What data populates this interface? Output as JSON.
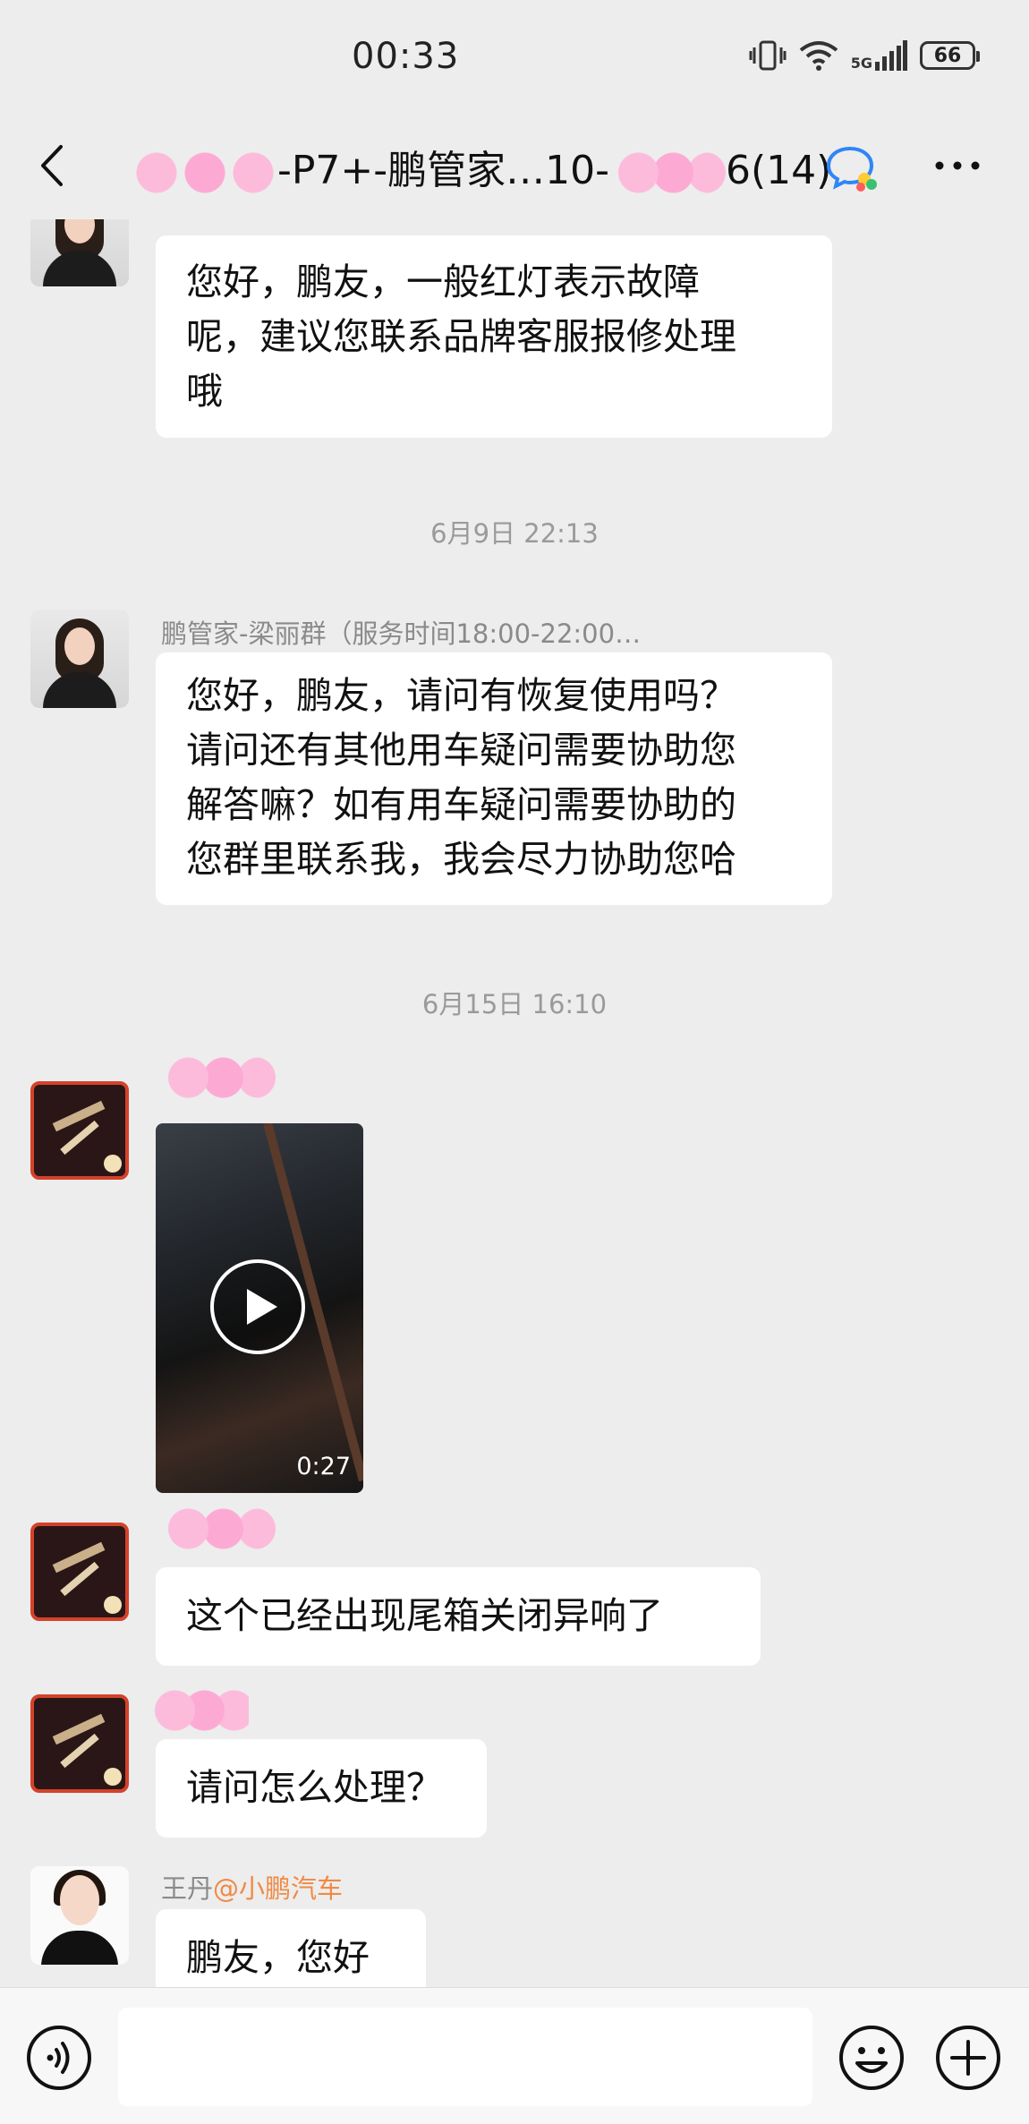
{
  "status_bar": {
    "time": "00:33",
    "network": "5G",
    "battery": "66",
    "icons": [
      "vibrate-icon",
      "wifi-icon",
      "signal-icon",
      "battery-icon"
    ]
  },
  "header": {
    "title_part1": "-P7+-鹏管家…10-",
    "title_part2": "6(14)",
    "icons": [
      "back-arrow-icon",
      "group-chat-icon",
      "more-icon"
    ]
  },
  "messages": [
    {
      "type": "text",
      "sender": "",
      "text_lines": [
        "您好，鹏友，一般红灯表示故障",
        "呢，建议您联系品牌客服报修处理",
        "哦"
      ]
    },
    {
      "type": "timestamp",
      "text": "6月9日 22:13"
    },
    {
      "type": "text",
      "sender": "鹏管家-梁丽群（服务时间18:00-22:00…",
      "text_lines": [
        "您好，鹏友，请问有恢复使用吗？",
        "请问还有其他用车疑问需要协助您",
        "解答嘛？如有用车疑问需要协助的",
        "您群里联系我，我会尽力协助您哈"
      ]
    },
    {
      "type": "timestamp",
      "text": "6月15日 16:10"
    },
    {
      "type": "video",
      "sender": "",
      "duration": "0:27"
    },
    {
      "type": "text",
      "sender": "",
      "text_lines": [
        "这个已经出现尾箱关闭异响了"
      ]
    },
    {
      "type": "text",
      "sender": "",
      "text_lines": [
        "请问怎么处理？"
      ]
    },
    {
      "type": "text",
      "sender_name": "王丹",
      "sender_org": "@小鹏汽车",
      "text_lines": [
        "鹏友，您好"
      ]
    }
  ],
  "input_bar": {
    "icons": [
      "voice-icon",
      "emoji-icon",
      "plus-icon"
    ],
    "placeholder": ""
  }
}
